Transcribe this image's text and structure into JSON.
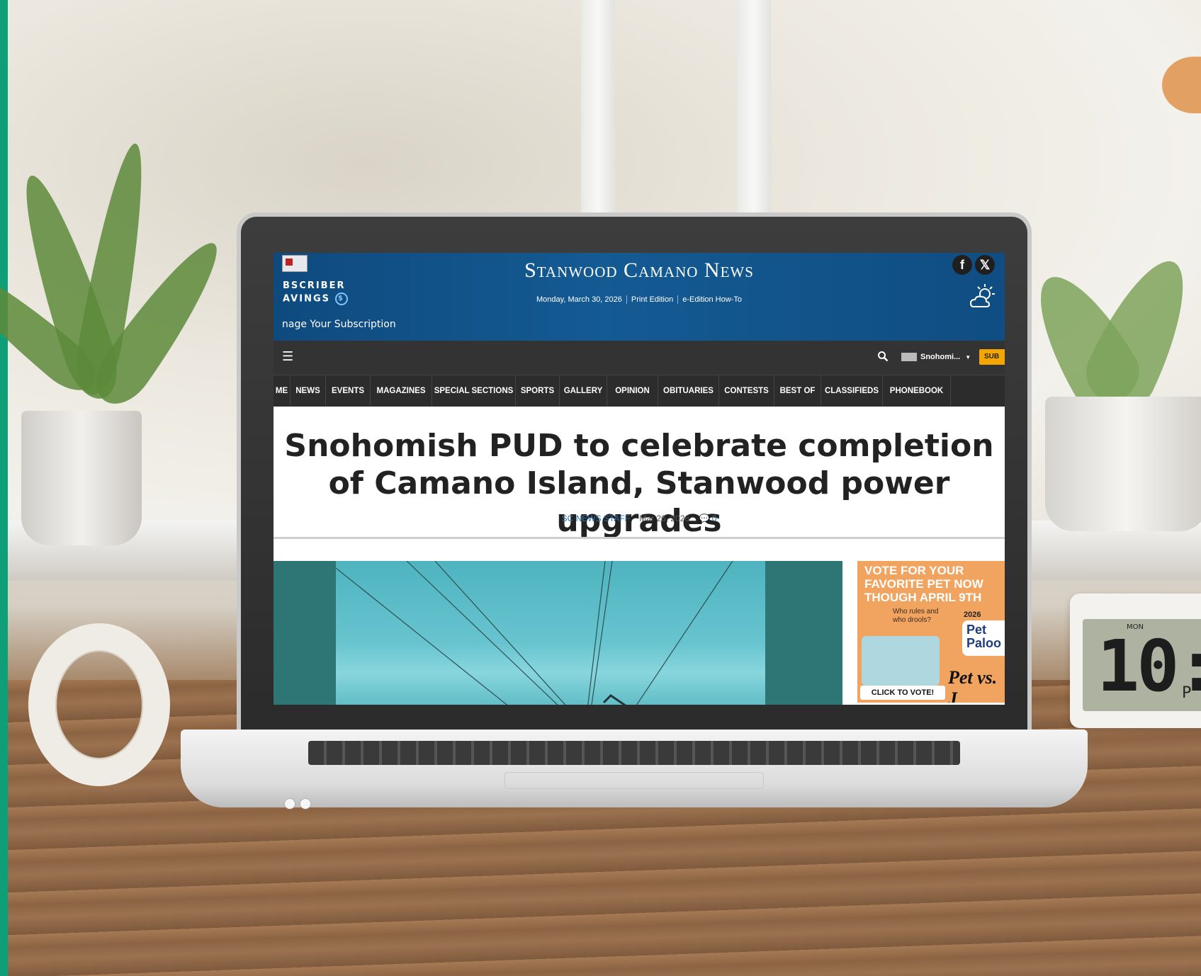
{
  "site": {
    "title": "Stanwood Camano News",
    "date": "Monday, March 30, 2026",
    "print_edition": "Print Edition",
    "eedition_howto": "e-Edition How-To",
    "subscriber_savings_line1": "BSCRIBER",
    "subscriber_savings_line2": "AVINGS",
    "manage_subscription": "nage Your Subscription"
  },
  "topbar": {
    "menu_glyph": "☰",
    "location": "Snohomi...",
    "subscribe": "SUB"
  },
  "nav": {
    "items": [
      "ME",
      "NEWS",
      "EVENTS",
      "MAGAZINES",
      "SPECIAL SECTIONS",
      "SPORTS",
      "GALLERY",
      "OPINION",
      "OBITUARIES",
      "CONTESTS",
      "BEST OF",
      "CLASSIFIEDS",
      "PHONEBOOK"
    ]
  },
  "article": {
    "headline": "Snohomish PUD to celebrate completion of Camano Island, Stanwood power upgrades",
    "author": "SC NEWS STAFF",
    "date": "Mar 26, 2026",
    "comments": "0"
  },
  "ad": {
    "headline": "VOTE FOR YOUR FAVORITE PET NOW THOUGH APRIL 9TH",
    "small": "Who rules and who drools?",
    "year": "2026",
    "brand": "Pet Paloo",
    "vs": "Pet vs. J",
    "cta": "CLICK TO VOTE!"
  },
  "clock": {
    "day": "MON",
    "time": "10:",
    "meridiem": "P"
  },
  "icons": [
    "facebook-icon",
    "x-icon",
    "weather-icon",
    "search-icon",
    "menu-icon",
    "comment-icon",
    "user-icon",
    "caret-down-icon"
  ]
}
